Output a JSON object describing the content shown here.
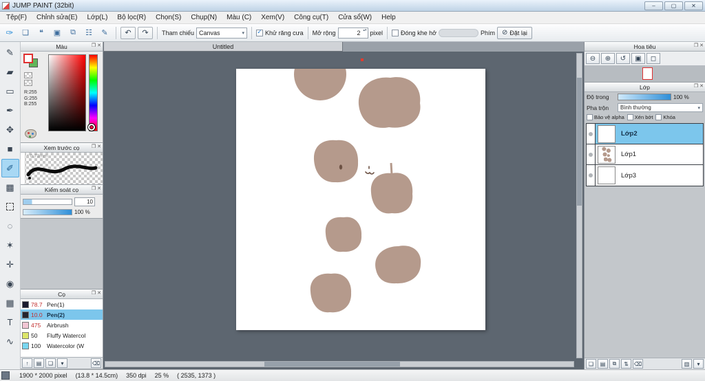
{
  "window": {
    "title": "JUMP PAINT (32bit)"
  },
  "menu": {
    "items": [
      "Tệp(F)",
      "Chỉnh sửa(E)",
      "Lớp(L)",
      "Bộ lọc(R)",
      "Chọn(S)",
      "Chụp(N)",
      "Màu (C)",
      "Xem(V)",
      "Công cụ(T)",
      "Cửa sổ(W)",
      "Help"
    ]
  },
  "toolbar": {
    "reference_label": "Tham chiếu",
    "reference_value": "Canvas",
    "antialias_label": "Khử răng cưa",
    "antialias_checked": true,
    "expand_label": "Mở rộng",
    "expand_value": "2",
    "expand_unit": "pixel",
    "close_gap_label": "Đóng khe hở",
    "close_gap_checked": false,
    "key_label": "Phím",
    "reset_label": "Đặt lại"
  },
  "color_panel": {
    "title": "Màu",
    "r": "R:255",
    "g": "G:255",
    "b": "B:255"
  },
  "brush_preview_panel": {
    "title": "Xem trước cọ",
    "size_label": "* 0.73mm"
  },
  "brush_control_panel": {
    "title": "Kiểm soát cọ",
    "size_value": "10",
    "opacity_value": "100 %"
  },
  "brush_panel": {
    "title": "Cọ",
    "items": [
      {
        "size": "78.7",
        "name": "Pen(1)",
        "swatch_css": "background:#1b1b2e"
      },
      {
        "size": "10.0",
        "name": "Pen(2)",
        "swatch_css": "background:#24242e"
      },
      {
        "size": "475",
        "name": "Airbrush",
        "swatch_css": "background:#f2c6d4"
      },
      {
        "size": "50",
        "name": "Fluffy Watercol",
        "swatch_css": "background:#dde76a"
      },
      {
        "size": "100",
        "name": "Watercolor (W",
        "swatch_css": "background:#79d7f0"
      }
    ]
  },
  "canvas": {
    "tab_title": "Untitled"
  },
  "navigator_panel": {
    "title": "Hoa tiêu"
  },
  "layer_panel": {
    "title": "Lớp",
    "opacity_label": "Độ trong",
    "opacity_value": "100 %",
    "blend_label": "Pha trộn",
    "blend_value": "Bình thường",
    "protect_alpha_label": "Bảo vệ alpha",
    "clipping_label": "Xén bớt",
    "lock_label": "Khóa",
    "layers": [
      {
        "name": "Lớp2",
        "selected": true
      },
      {
        "name": "Lớp1",
        "selected": false
      },
      {
        "name": "Lớp3",
        "selected": false
      }
    ]
  },
  "status_bar": {
    "dimensions": "1900 * 2000 pixel",
    "physical": "(13.8 * 14.5cm)",
    "dpi": "350 dpi",
    "zoom": "25 %",
    "coords": "( 2535, 1373 )"
  },
  "colors": {
    "selection_blue": "#7cc6ec",
    "canvas_bg": "#5d6670",
    "artwork_tan": "#b59a8c"
  },
  "icons": {
    "minimize": "–",
    "maximize": "▢",
    "close": "✕",
    "undo": "↶",
    "redo": "↷",
    "caret_down": "▾",
    "check": "✓",
    "reset_slash": "⊘",
    "popout": "❐",
    "panel_close": "✕",
    "zoom_out": "⊖",
    "zoom_in": "⊕",
    "zoom_reset": "↺",
    "zoom_fit": "▣",
    "zoom_pixel": "◻",
    "toolbar_icons": [
      "✑",
      "❏",
      "❝",
      "▣",
      "⧉",
      "☷",
      "✎"
    ],
    "tools": [
      "✎",
      "▰",
      "▭",
      "✒",
      "✥",
      "■",
      "✐",
      "▩",
      "",
      "◌",
      "✶",
      "✛",
      "◉",
      "▦",
      "T",
      "∿"
    ],
    "brush_bar": [
      "↑",
      "▤",
      "❏",
      "▾",
      "⌫"
    ],
    "layer_bar": [
      "❏",
      "▤",
      "⧉",
      "⇅",
      "⌫",
      "▥",
      "▾"
    ]
  }
}
